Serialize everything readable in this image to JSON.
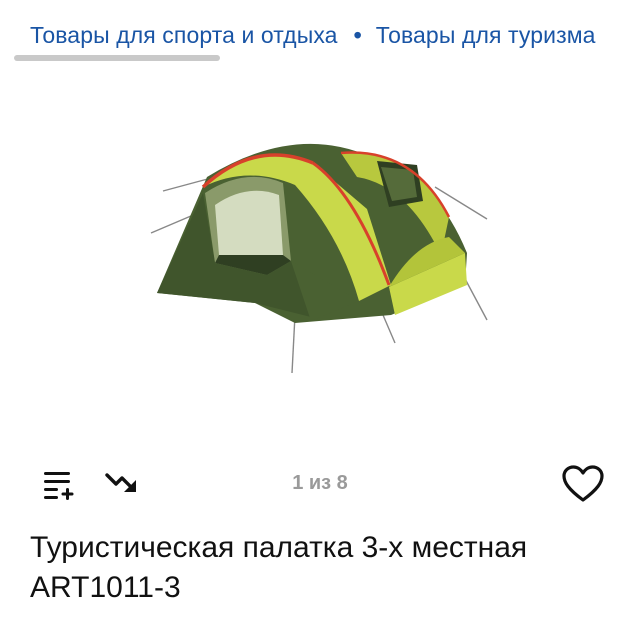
{
  "breadcrumb": {
    "items": [
      "Товары для спорта и отдыха",
      "Товары для туризма"
    ],
    "separator": "•"
  },
  "gallery": {
    "counter": "1 из 8",
    "image_alt_name": "tent-image"
  },
  "toolbar": {
    "compare_icon": "add-to-list-icon",
    "trend_icon": "price-trend-icon",
    "favorite_icon": "heart-icon"
  },
  "product": {
    "title": "Туристическая палатка 3-х местная ART1011-3"
  },
  "colors": {
    "link": "#1a55a5",
    "text": "#111111",
    "muted": "#9a9a9a",
    "tent_dark": "#4a6132",
    "tent_light": "#c9d94a",
    "tent_trim": "#d8412b"
  }
}
